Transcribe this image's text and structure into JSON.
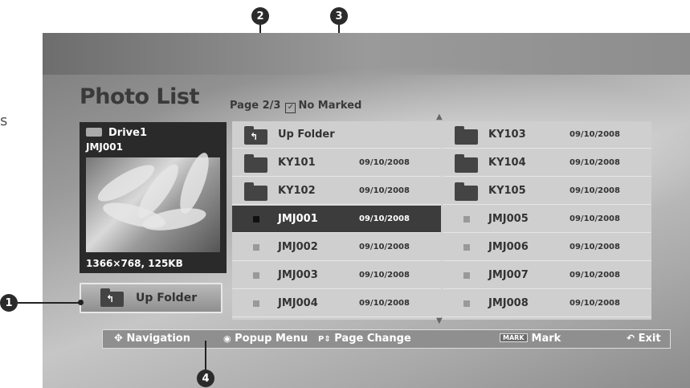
{
  "stray_text": "s",
  "callouts": [
    "1",
    "2",
    "3",
    "4"
  ],
  "title": "Photo List",
  "page_info": {
    "page": "Page 2/3",
    "marked": "No Marked"
  },
  "preview": {
    "drive": "Drive1",
    "file": "JMJ001",
    "resolution": "1366×768, 125KB"
  },
  "up_folder_button": "Up Folder",
  "file_grid": {
    "left": [
      {
        "name": "Up Folder",
        "date": "",
        "kind": "up"
      },
      {
        "name": "KY101",
        "date": "09/10/2008",
        "kind": "folder"
      },
      {
        "name": "KY102",
        "date": "09/10/2008",
        "kind": "folder"
      },
      {
        "name": "JMJ001",
        "date": "09/10/2008",
        "kind": "photo",
        "selected": true
      },
      {
        "name": "JMJ002",
        "date": "09/10/2008",
        "kind": "photo"
      },
      {
        "name": "JMJ003",
        "date": "09/10/2008",
        "kind": "photo"
      },
      {
        "name": "JMJ004",
        "date": "09/10/2008",
        "kind": "photo"
      }
    ],
    "right": [
      {
        "name": "KY103",
        "date": "09/10/2008",
        "kind": "folder"
      },
      {
        "name": "KY104",
        "date": "09/10/2008",
        "kind": "folder"
      },
      {
        "name": "KY105",
        "date": "09/10/2008",
        "kind": "folder"
      },
      {
        "name": "JMJ005",
        "date": "09/10/2008",
        "kind": "photo"
      },
      {
        "name": "JMJ006",
        "date": "09/10/2008",
        "kind": "photo"
      },
      {
        "name": "JMJ007",
        "date": "09/10/2008",
        "kind": "photo"
      },
      {
        "name": "JMJ008",
        "date": "09/10/2008",
        "kind": "photo"
      }
    ]
  },
  "bottom_bar": {
    "navigation": "Navigation",
    "popup": "Popup Menu",
    "page_change": "Page Change",
    "mark_badge": "MARK",
    "mark": "Mark",
    "exit": "Exit"
  }
}
